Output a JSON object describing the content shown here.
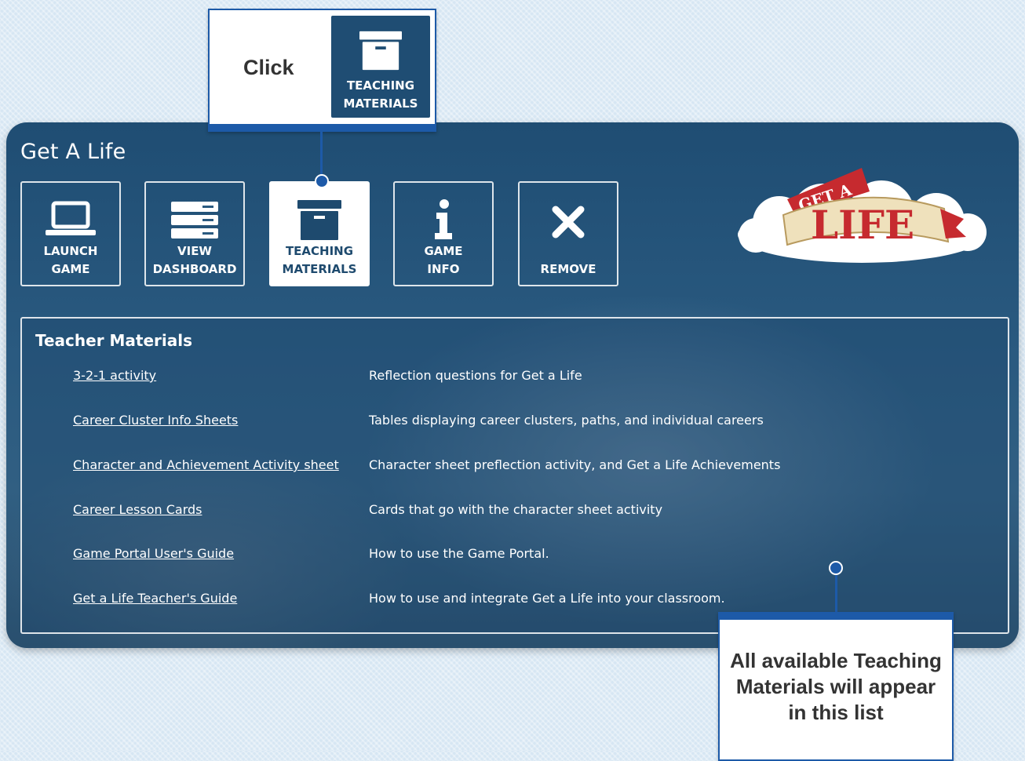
{
  "callout_top": {
    "instruction": "Click",
    "tile_label": "TEACHING\nMATERIALS"
  },
  "game_panel": {
    "title": "Get A Life",
    "tiles": [
      {
        "label": "LAUNCH\nGAME",
        "icon": "laptop-icon"
      },
      {
        "label": "VIEW\nDASHBOARD",
        "icon": "server-icon"
      },
      {
        "label": "TEACHING\nMATERIALS",
        "icon": "archive-box-icon",
        "active": true
      },
      {
        "label": "GAME\nINFO",
        "icon": "info-icon"
      },
      {
        "label": "REMOVE",
        "icon": "x-icon"
      }
    ],
    "logo": {
      "line1": "GET A",
      "line2": "LIFE"
    }
  },
  "teacher_materials": {
    "title": "Teacher Materials",
    "items": [
      {
        "link": "3-2-1 activity",
        "description": "Reflection questions for Get a Life"
      },
      {
        "link": "Career Cluster Info Sheets",
        "description": "Tables displaying career clusters, paths, and individual careers"
      },
      {
        "link": "Character and Achievement Activity sheet",
        "description": "Character sheet preflection activity, and Get a Life Achievements"
      },
      {
        "link": "Career Lesson Cards",
        "description": "Cards that go with the character sheet activity"
      },
      {
        "link": "Game Portal User's Guide",
        "description": "How to use the Game Portal."
      },
      {
        "link": "Get a Life Teacher's Guide",
        "description": "How to use and integrate Get a Life into your classroom."
      }
    ]
  },
  "callout_bottom": {
    "text": "All available Teaching\nMaterials will appear\nin this list"
  },
  "colors": {
    "panel": "#1f4d73",
    "callout_accent": "#1d5aa8",
    "page_background": "#d6e6f3"
  }
}
